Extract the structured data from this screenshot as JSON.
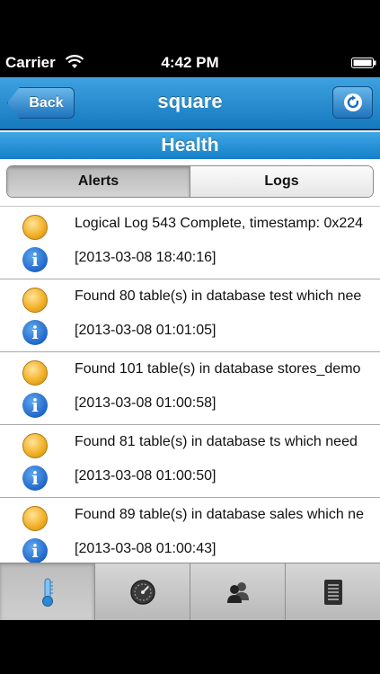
{
  "status_bar": {
    "carrier": "Carrier",
    "time": "4:42 PM"
  },
  "nav": {
    "back_label": "Back",
    "title": "square"
  },
  "section": {
    "title": "Health"
  },
  "segments": [
    {
      "label": "Alerts",
      "selected": true
    },
    {
      "label": "Logs",
      "selected": false
    }
  ],
  "log_entries": [
    {
      "message": "Logical Log 543 Complete, timestamp: 0x224",
      "timestamp": "[2013-03-08 18:40:16]"
    },
    {
      "message": "Found 80 table(s) in database test which nee",
      "timestamp": "[2013-03-08 01:01:05]"
    },
    {
      "message": "Found 101 table(s) in database stores_demo",
      "timestamp": "[2013-03-08 01:00:58]"
    },
    {
      "message": "Found 81 table(s) in database ts which need",
      "timestamp": "[2013-03-08 01:00:50]"
    },
    {
      "message": "Found 89 table(s) in database sales which ne",
      "timestamp": "[2013-03-08 01:00:43]"
    }
  ],
  "tabs": [
    {
      "icon": "thermometer-icon",
      "active": true
    },
    {
      "icon": "gauge-icon",
      "active": false
    },
    {
      "icon": "users-icon",
      "active": false
    },
    {
      "icon": "document-icon",
      "active": false
    }
  ],
  "colors": {
    "nav_blue": "#1e88d4",
    "warning_dot": "#f3b12a",
    "info_blue": "#1f66c8"
  }
}
